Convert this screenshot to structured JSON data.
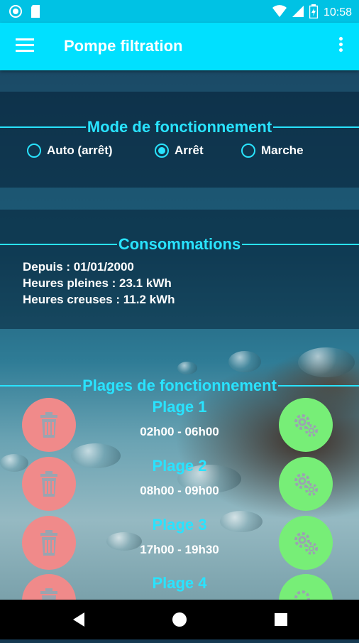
{
  "status_bar": {
    "time": "10:58"
  },
  "app_bar": {
    "title": "Pompe filtration"
  },
  "mode": {
    "title": "Mode de fonctionnement",
    "options": [
      {
        "label": "Auto (arrêt)",
        "selected": false
      },
      {
        "label": "Arrêt",
        "selected": true
      },
      {
        "label": "Marche",
        "selected": false
      }
    ]
  },
  "consommations": {
    "title": "Consommations",
    "lines": [
      "Depuis : 01/01/2000",
      "Heures pleines : 23.1 kWh",
      "Heures creuses : 11.2 kWh"
    ]
  },
  "plages": {
    "title": "Plages de fonctionnement",
    "items": [
      {
        "name": "Plage 1",
        "hours": "02h00 - 06h00"
      },
      {
        "name": "Plage 2",
        "hours": "08h00 - 09h00"
      },
      {
        "name": "Plage 3",
        "hours": "17h00 - 19h30"
      },
      {
        "name": "Plage 4",
        "hours": ""
      }
    ]
  },
  "colors": {
    "accent": "#29e3ff",
    "appbar": "#00e0ff",
    "delete": "#f08a8a",
    "config": "#77ee77"
  }
}
